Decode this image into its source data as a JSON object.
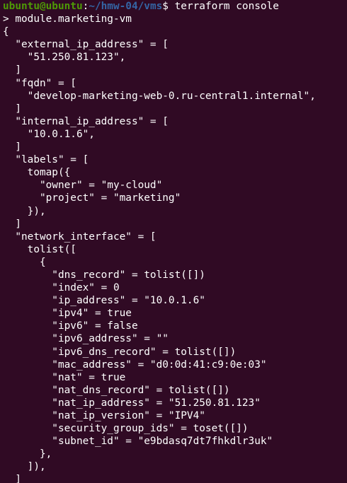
{
  "prompt": {
    "user_host": "ubuntu@ubuntu",
    "separator": ":",
    "path": "~/hmw-04/vms",
    "symbol": "$",
    "command": " terraform console"
  },
  "lines": [
    "> module.marketing-vm",
    "{",
    "  \"external_ip_address\" = [",
    "    \"51.250.81.123\",",
    "  ]",
    "  \"fqdn\" = [",
    "    \"develop-marketing-web-0.ru-central1.internal\",",
    "  ]",
    "  \"internal_ip_address\" = [",
    "    \"10.0.1.6\",",
    "  ]",
    "  \"labels\" = [",
    "    tomap({",
    "      \"owner\" = \"my-cloud\"",
    "      \"project\" = \"marketing\"",
    "    }),",
    "  ]",
    "  \"network_interface\" = [",
    "    tolist([",
    "      {",
    "        \"dns_record\" = tolist([])",
    "        \"index\" = 0",
    "        \"ip_address\" = \"10.0.1.6\"",
    "        \"ipv4\" = true",
    "        \"ipv6\" = false",
    "        \"ipv6_address\" = \"\"",
    "        \"ipv6_dns_record\" = tolist([])",
    "        \"mac_address\" = \"d0:0d:41:c9:0e:03\"",
    "        \"nat\" = true",
    "        \"nat_dns_record\" = tolist([])",
    "        \"nat_ip_address\" = \"51.250.81.123\"",
    "        \"nat_ip_version\" = \"IPV4\"",
    "        \"security_group_ids\" = toset([])",
    "        \"subnet_id\" = \"e9bdasq7dt7fhkdlr3uk\"",
    "      },",
    "    ]),",
    "  ]"
  ],
  "colors": {
    "background": "#300a24",
    "text": "#ffffff",
    "user_host": "#4e9a06",
    "path": "#3465a4"
  }
}
